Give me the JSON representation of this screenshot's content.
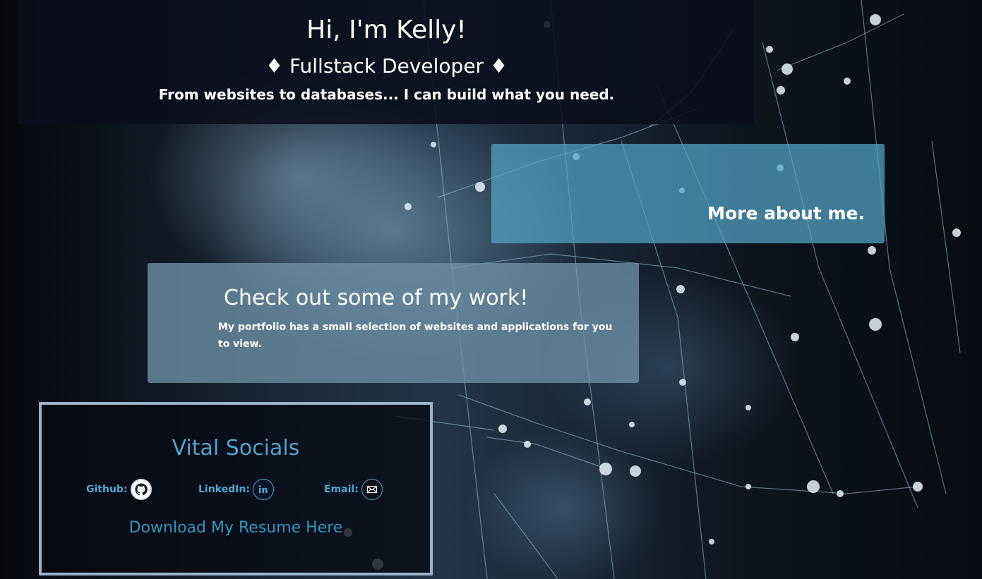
{
  "hero": {
    "greeting": "Hi, I'm Kelly!",
    "role": "♦ Fullstack Developer ♦",
    "tagline": "From websites to databases... I can build what you need."
  },
  "about": {
    "label": "More about me."
  },
  "work": {
    "title": "Check out some of my work!",
    "description": "My portfolio has a small selection of websites and applications for you to view."
  },
  "socials": {
    "heading": "Vital Socials",
    "links": [
      {
        "label": "Github:",
        "icon": "github-icon"
      },
      {
        "label": "LinkedIn:",
        "icon": "linkedin-icon"
      },
      {
        "label": "Email:",
        "icon": "email-icon"
      }
    ],
    "resume": "Download My Resume Here"
  },
  "colors": {
    "accent": "#52a7cf",
    "about_card": "#54a5c8",
    "work_card": "#7091a5"
  }
}
